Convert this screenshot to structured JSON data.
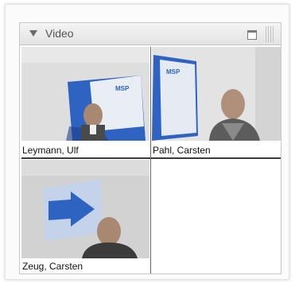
{
  "panel": {
    "title": "Video"
  },
  "participants": [
    {
      "name": "Leymann, Ulf",
      "sign_text": "MSP"
    },
    {
      "name": "Pahl, Carsten",
      "sign_text": "MSP"
    },
    {
      "name": "Zeug, Carsten"
    }
  ]
}
